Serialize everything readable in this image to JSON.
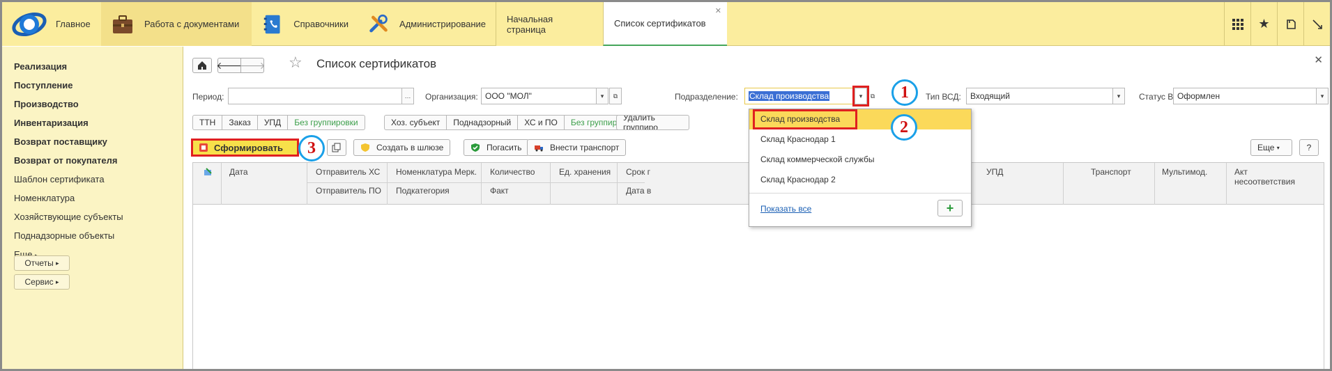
{
  "topbar": {
    "home": "Главное",
    "sections": [
      "Работа с документами",
      "Справочники",
      "Администрирование"
    ],
    "tabs": [
      {
        "label": "Начальная страница",
        "active": false
      },
      {
        "label": "Список сертификатов",
        "active": true
      }
    ]
  },
  "sidebar": {
    "items": [
      "Реализация",
      "Поступление",
      "Производство",
      "Инвентаризация",
      "Возврат поставщику",
      "Возврат от покупателя",
      "Шаблон сертификата",
      "Номенклатура",
      "Хозяйствующие субъекты",
      "Поднадзорные объекты",
      "Еще"
    ],
    "buttons": [
      "Отчеты",
      "Сервис"
    ]
  },
  "page": {
    "title": "Список сертификатов",
    "filters": {
      "period_label": "Период:",
      "period_value": "",
      "org_label": "Организация:",
      "org_value": "ООО \"МОЛ\"",
      "division_label": "Подразделение:",
      "division_value": "Склад производства",
      "vsd_type_label": "Тип ВСД:",
      "vsd_type_value": "Входящий",
      "vsd_status_label": "Статус ВСД:",
      "vsd_status_value": "Оформлен"
    },
    "groups1": [
      "ТТН",
      "Заказ",
      "УПД",
      "Без группировки"
    ],
    "groups2": [
      "Хоз. субъект",
      "Поднадзорный",
      "ХС и ПО",
      "Без группировки"
    ],
    "delete_group": "Удалить группиро",
    "toolbar": {
      "form": "Сформировать",
      "create_gateway": "Создать в шлюзе",
      "repay": "Погасить",
      "add_transport": "Внести транспорт",
      "more": "Еще",
      "help": "?"
    },
    "columns": {
      "date": "Дата",
      "sender_hs": "Отправитель ХС",
      "sender_po": "Отправитель ПО",
      "nomenclature": "Номенклатура Мерк.",
      "subcategory": "Подкатегория",
      "quantity": "Количество",
      "fact": "Факт",
      "storage_unit": "Ед. хранения",
      "term": "Срок г",
      "date_b": "Дата в",
      "upd": "УПД",
      "transport": "Транспорт",
      "multimod": "Мультимод.",
      "act_line1": "Акт",
      "act_line2": "несоответствия"
    },
    "dropdown": {
      "items": [
        "Склад производства",
        "Склад Краснодар 1",
        "Склад коммерческой службы",
        "Склад Краснодар 2"
      ],
      "selected": 0,
      "show_all": "Показать все"
    },
    "callouts": [
      "1",
      "2",
      "3"
    ]
  },
  "colors": {
    "topbar_bg": "#fbed9e",
    "sidebar_bg": "#fbf4c4",
    "highlight": "#fbd95a",
    "accent_green": "#3c9f4a",
    "callout_ring": "#1aa0e8",
    "callout_text": "#d01010",
    "red_marker": "#e02020"
  }
}
